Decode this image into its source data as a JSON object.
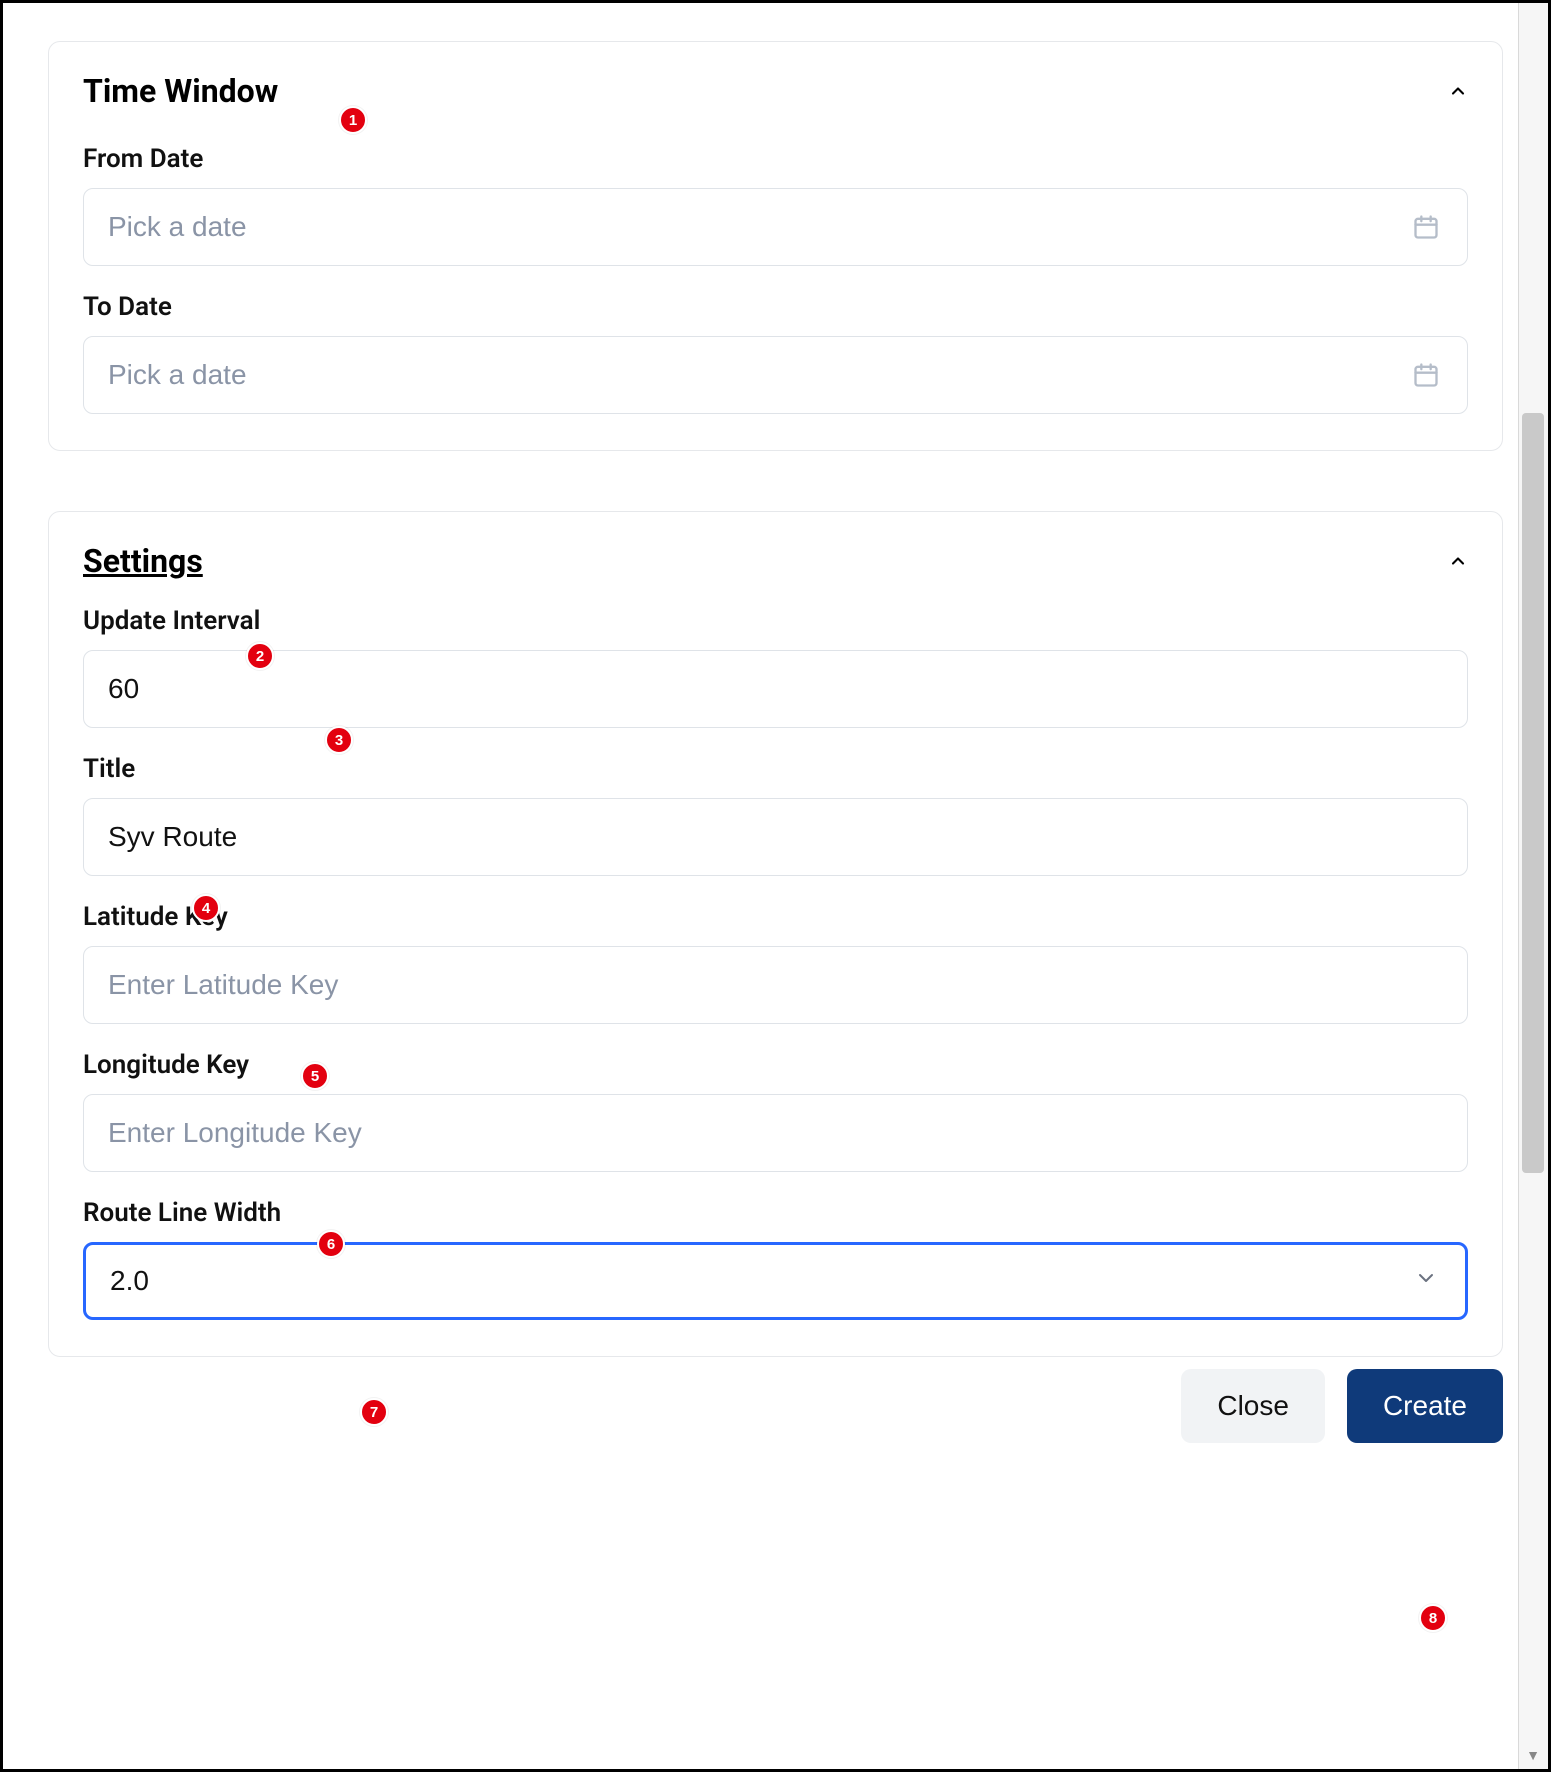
{
  "time_window": {
    "title": "Time Window",
    "from_label": "From Date",
    "from_placeholder": "Pick a date",
    "from_value": "",
    "to_label": "To Date",
    "to_placeholder": "Pick a date",
    "to_value": ""
  },
  "settings": {
    "title": "Settings",
    "update_interval_label": "Update Interval",
    "update_interval_value": "60",
    "title_label": "Title",
    "title_value": "Syv Route",
    "lat_key_label": "Latitude Key",
    "lat_key_placeholder": "Enter Latitude Key",
    "lon_key_label": "Longitude Key",
    "lon_key_placeholder": "Enter Longitude Key",
    "line_width_label": "Route Line Width",
    "line_width_value": "2.0"
  },
  "footer": {
    "close_label": "Close",
    "create_label": "Create"
  },
  "badges": [
    "1",
    "2",
    "3",
    "4",
    "5",
    "6",
    "7",
    "8"
  ]
}
